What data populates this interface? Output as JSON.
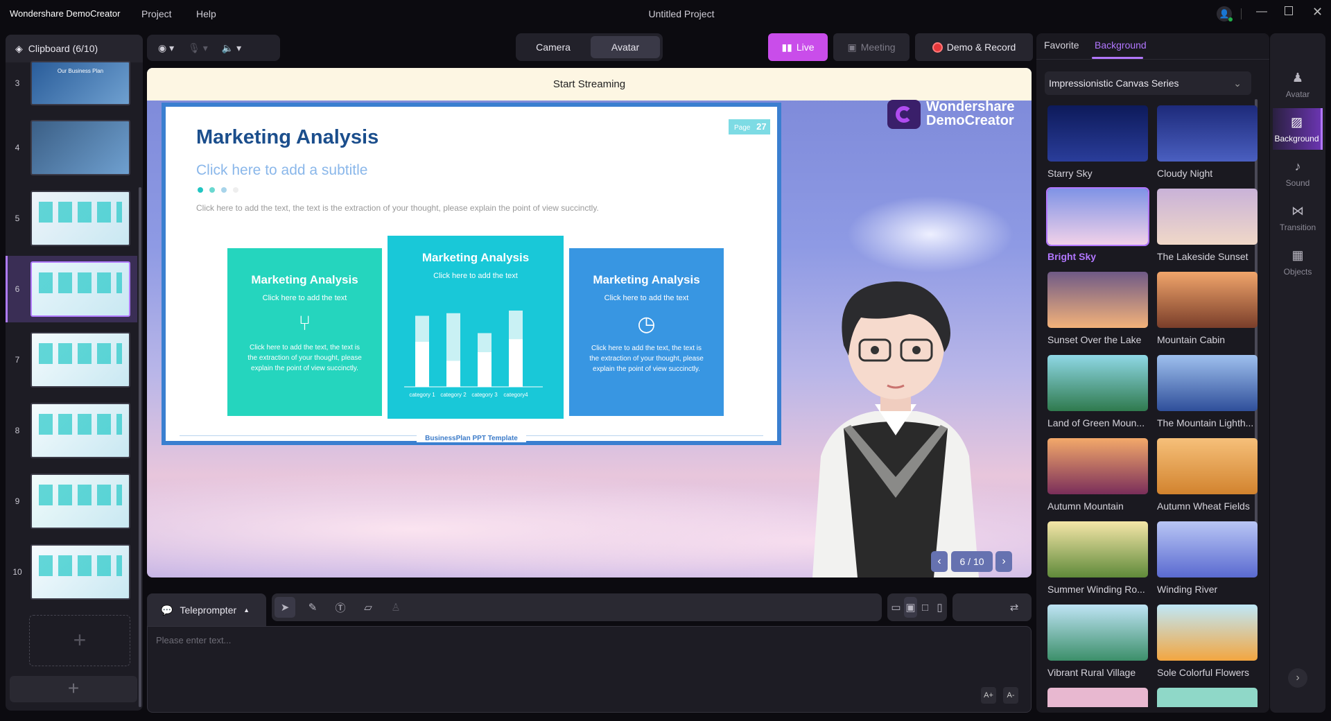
{
  "titlebar": {
    "app_name": "Wondershare DemoCreator",
    "menu": [
      "Project",
      "Help"
    ],
    "project_title": "Untitled Project"
  },
  "clipboard": {
    "title": "Clipboard (6/10)",
    "active_slide": 6,
    "slides": [
      {
        "num": "3",
        "caption": "Our Business Plan"
      },
      {
        "num": "4"
      },
      {
        "num": "5"
      },
      {
        "num": "6"
      },
      {
        "num": "7"
      },
      {
        "num": "8"
      },
      {
        "num": "9"
      },
      {
        "num": "10"
      }
    ],
    "add_icon": "plus-icon"
  },
  "toolbar": {
    "camera_label": "Camera",
    "avatar_label": "Avatar",
    "active_mode": "Avatar",
    "live_label": "Live",
    "meeting_label": "Meeting",
    "demo_record_label": "Demo & Record",
    "live_color": "#c94dea",
    "record_color": "#e5383b"
  },
  "preview": {
    "banner": "Start Streaming",
    "logo_line1": "Wondershare",
    "logo_line2": "DemoCreator",
    "pager": "6 / 10"
  },
  "slide": {
    "title": "Marketing Analysis",
    "subtitle": "Click here to add a subtitle",
    "body": "Click here to add the text, the text is the extraction of your thought, please explain the point of view succinctly.",
    "page_label": "Page",
    "page_num": "27",
    "footer": "BusinessPlan PPT Template",
    "cards": [
      {
        "title": "Marketing Analysis",
        "sub": "Click here to add the text",
        "desc": "Click here to add the text, the text is the extraction of your thought, please explain the point of view succinctly.",
        "icon": "office-chair-icon",
        "color": "#25d5be"
      },
      {
        "title": "Marketing Analysis",
        "sub": "Click here to add the text",
        "color": "#19c8d8"
      },
      {
        "title": "Marketing Analysis",
        "sub": "Click here to add the text",
        "desc": "Click here to add the text, the text is the extraction of your thought, please explain the point of view succinctly.",
        "icon": "clock-icon",
        "color": "#3896e2"
      }
    ],
    "chart": {
      "categories": [
        "category 1",
        "category 2",
        "category 3",
        "category4"
      ],
      "totals": [
        0.82,
        0.85,
        0.62,
        0.88
      ],
      "lower": [
        0.52,
        0.3,
        0.4,
        0.55
      ]
    }
  },
  "teleprompter": {
    "label": "Teleprompter",
    "placeholder": "Please enter text...",
    "font_up": "A+",
    "font_down": "A-"
  },
  "right_panel": {
    "tabs": [
      "Favorite",
      "Background"
    ],
    "active_tab": "Background",
    "dropdown": "Impressionistic Canvas Series",
    "selected": "Bright Sky",
    "backgrounds": [
      {
        "name": "Starry Sky",
        "colors": [
          "#0d1a5a",
          "#2a3d9a"
        ]
      },
      {
        "name": "Cloudy Night",
        "colors": [
          "#1d2a7a",
          "#4a5fc0"
        ]
      },
      {
        "name": "Bright Sky",
        "colors": [
          "#7f93e6",
          "#f1d1e8"
        ]
      },
      {
        "name": "The Lakeside Sunset",
        "colors": [
          "#c9b2d8",
          "#f0d8c8"
        ]
      },
      {
        "name": "Sunset Over the Lake",
        "colors": [
          "#6f5a86",
          "#f3b27a"
        ]
      },
      {
        "name": "Mountain Cabin",
        "colors": [
          "#f1a56b",
          "#7a3e2a"
        ]
      },
      {
        "name": "Land of Green Moun...",
        "colors": [
          "#8fd8e6",
          "#2f7a4e"
        ]
      },
      {
        "name": "The Mountain Lighth...",
        "colors": [
          "#9fc0ee",
          "#2f4f9a"
        ]
      },
      {
        "name": "Autumn Mountain",
        "colors": [
          "#f3a96a",
          "#7a2e5a"
        ]
      },
      {
        "name": "Autumn Wheat Fields",
        "colors": [
          "#f6c07a",
          "#d2832e"
        ]
      },
      {
        "name": "Summer Winding Ro...",
        "colors": [
          "#f5e6a8",
          "#5f8a3a"
        ]
      },
      {
        "name": "Winding River",
        "colors": [
          "#b9c6f5",
          "#5a6ad0"
        ]
      },
      {
        "name": "Vibrant Rural Village",
        "colors": [
          "#bfe4f5",
          "#3c8f6a"
        ]
      },
      {
        "name": "Sole Colorful Flowers",
        "colors": [
          "#bfe8f8",
          "#f3a640"
        ]
      }
    ]
  },
  "side_nav": {
    "items": [
      {
        "label": "Avatar",
        "icon": "avatar-icon"
      },
      {
        "label": "Background",
        "icon": "background-icon"
      },
      {
        "label": "Sound",
        "icon": "music-note-icon"
      },
      {
        "label": "Transition",
        "icon": "transition-icon"
      },
      {
        "label": "Objects",
        "icon": "objects-icon"
      }
    ],
    "active": "Background"
  }
}
